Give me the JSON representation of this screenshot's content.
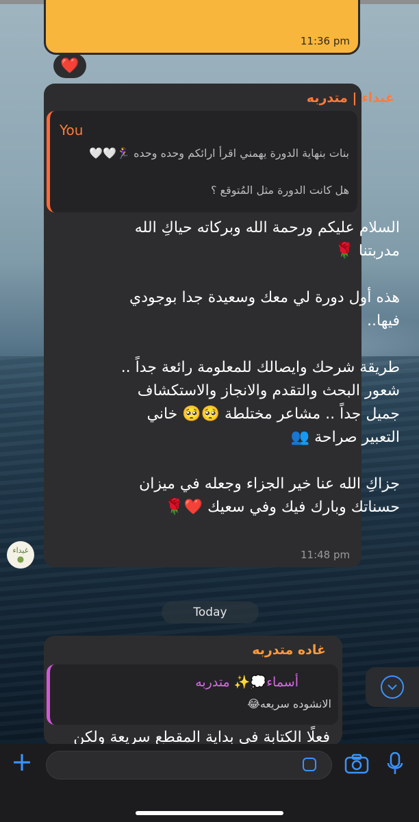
{
  "colors": {
    "accent": "#3a93ff",
    "outgoing_bubble": "#f9b63c",
    "incoming_bubble": "#2d2d2f",
    "sender_name": "#ff7a3a",
    "quote_accent_purple": "#d768e6"
  },
  "messages": {
    "outgoing_yellow": {
      "time": "11:36 pm",
      "reaction": "❤️"
    },
    "incoming_1": {
      "sender": "غيداء | متدربه",
      "reply": {
        "author": "You",
        "line1": "بنات بنهاية الدورة يهمني اقرأ ارائكم وحده وحده 🏃‍♀️🤍🤍",
        "line2": "هل كانت الدورة مثل المُتوقع ؟"
      },
      "paragraphs": [
        "السلام عليكم ورحمة الله وبركاته حياكِ الله مدربتنا 🌹",
        "هذه أول دورة لي معك وسعيدة جدا بوجودي فيها..",
        "طريقة شرحك وايصالك للمعلومة رائعة جداً .. شعور البحث والتقدم والانجاز والاستكشاف جميل جداً .. مشاعر مختلطة 🥺🥺 خاني التعبير صراحة 👥",
        "جزاكِ الله عنا خير الجزاء وجعله في ميزان حسناتك وبارك فيك وفي سعيك ❤️🌹"
      ],
      "time": "11:48 pm",
      "avatar_text": "غيداء"
    },
    "date_separator": "Today",
    "incoming_2": {
      "sender": "غاده متدربه",
      "reply": {
        "author": "أسماء💭✨ متدربه",
        "text": "الانشوده سريعه😂"
      },
      "partial_text": "فعلًا الكتابة في بداية المقطع سريعة ولكن"
    }
  },
  "input_bar": {
    "placeholder": "",
    "plus_icon": "plus-icon",
    "sticker_icon": "sticker-icon",
    "camera_icon": "camera-icon",
    "mic_icon": "microphone-icon"
  }
}
